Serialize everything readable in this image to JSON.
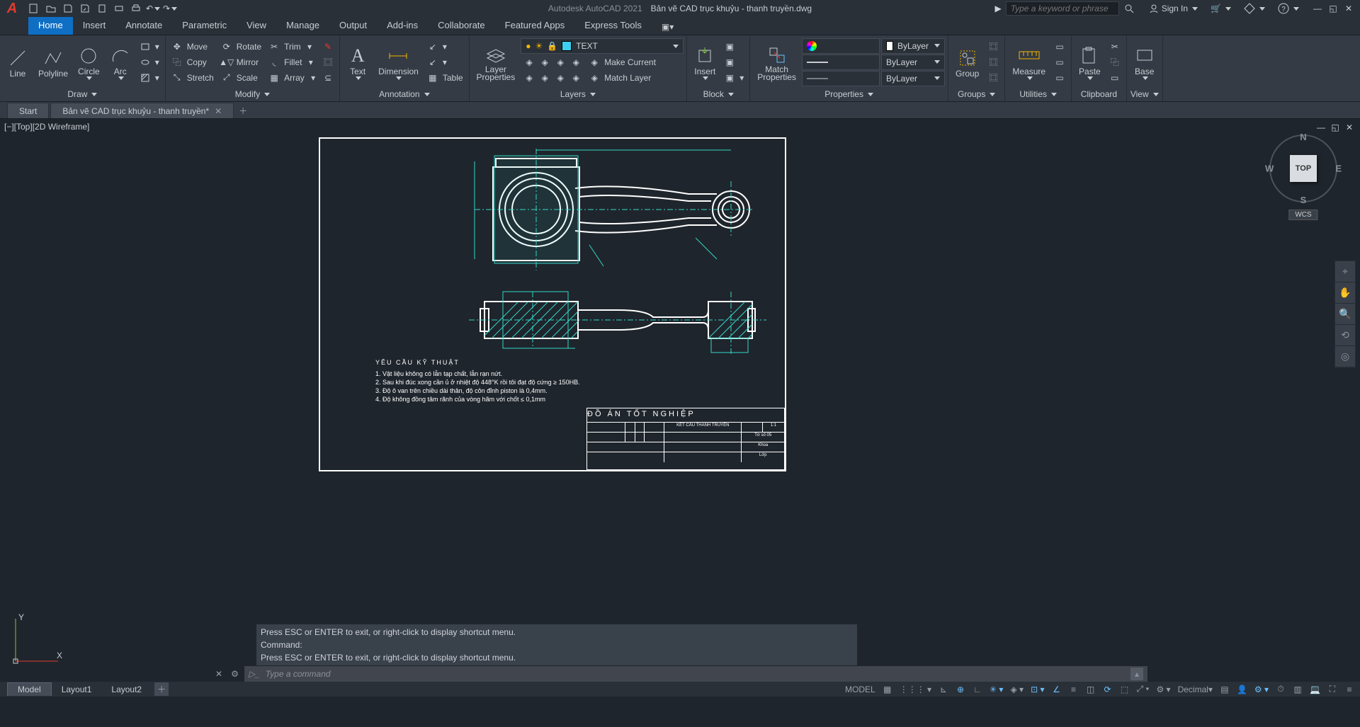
{
  "app": {
    "name": "Autodesk AutoCAD 2021",
    "document": "Bản vẽ CAD trục khuỷu - thanh truyền.dwg"
  },
  "search": {
    "placeholder": "Type a keyword or phrase"
  },
  "account": {
    "signin": "Sign In"
  },
  "ribbon_tabs": [
    "Home",
    "Insert",
    "Annotate",
    "Parametric",
    "View",
    "Manage",
    "Output",
    "Add-ins",
    "Collaborate",
    "Featured Apps",
    "Express Tools"
  ],
  "ribbon_active": "Home",
  "panels": {
    "draw": {
      "label": "Draw",
      "items": {
        "line": "Line",
        "polyline": "Polyline",
        "circle": "Circle",
        "arc": "Arc"
      }
    },
    "modify": {
      "label": "Modify",
      "items": {
        "move": "Move",
        "rotate": "Rotate",
        "trim": "Trim",
        "copy": "Copy",
        "mirror": "Mirror",
        "fillet": "Fillet",
        "stretch": "Stretch",
        "scale": "Scale",
        "array": "Array"
      }
    },
    "annotation": {
      "label": "Annotation",
      "items": {
        "text": "Text",
        "dimension": "Dimension",
        "table": "Table"
      }
    },
    "layers": {
      "label": "Layers",
      "big": "Layer\nProperties",
      "current": "TEXT",
      "make": "Make Current",
      "match": "Match Layer"
    },
    "block": {
      "label": "Block",
      "big": "Insert"
    },
    "properties": {
      "label": "Properties",
      "big": "Match\nProperties",
      "color": "ByLayer",
      "lw": "ByLayer",
      "lt": "ByLayer"
    },
    "groups": {
      "label": "Groups",
      "big": "Group"
    },
    "utilities": {
      "label": "Utilities",
      "big": "Measure"
    },
    "clipboard": {
      "label": "Clipboard",
      "big": "Paste"
    },
    "view": {
      "label": "View",
      "big": "Base"
    }
  },
  "file_tabs": [
    {
      "label": "Start",
      "closable": false
    },
    {
      "label": "Bản vẽ CAD trục khuỷu - thanh truyền*",
      "closable": true
    }
  ],
  "viewport": {
    "label": "[−][Top][2D Wireframe]"
  },
  "viewcube": {
    "face": "TOP",
    "wcs": "WCS",
    "n": "N",
    "e": "E",
    "s": "S",
    "w": "W"
  },
  "tech": {
    "heading": "YÊU CẦU KỸ THUẬT",
    "l1": "1. Vật liệu không có lẫn tạp chất, lẫn rạn nứt.",
    "l2": "2. Sau khi đúc xong cần ủ ở nhiệt độ 448°K rồi tôi đạt độ cứng ≥ 150HB.",
    "l3": "3. Độ ô van trên chiều dài thân, độ côn đỉnh piston là 0,4mm.",
    "l4": "4. Độ không đồng tâm rãnh của vòng hãm với chốt ≤ 0,1mm"
  },
  "titleblock": {
    "title": "ĐỒ ÁN TỐT NGHIỆP",
    "part": "KẾT CẤU THANH TRUYỀN",
    "scale": "1:1",
    "rows": [
      "Tờ số 05",
      "Khoa",
      "Lớp"
    ]
  },
  "cmd": {
    "h1": "Press ESC or ENTER to exit, or right-click to display shortcut menu.",
    "h2": "Command:",
    "h3": "Press ESC or ENTER to exit, or right-click to display shortcut menu.",
    "placeholder": "Type a command"
  },
  "layout_tabs": [
    "Model",
    "Layout1",
    "Layout2"
  ],
  "layout_active": "Model",
  "status": {
    "model": "MODEL",
    "units": "Decimal"
  },
  "ucs": {
    "x": "X",
    "y": "Y"
  }
}
